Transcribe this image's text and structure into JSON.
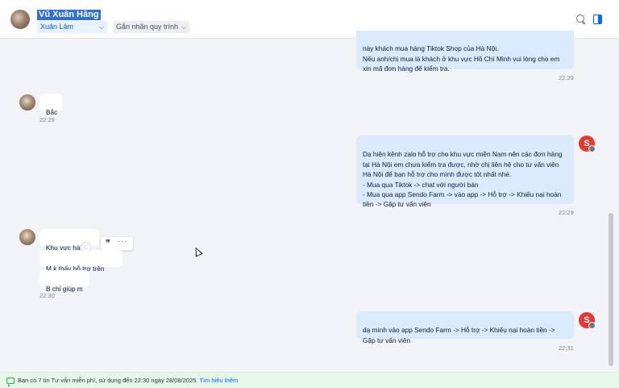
{
  "header": {
    "contact_name": "Vũ Xuân Hằng",
    "region_select": "Xuân Lâm",
    "tag_select": "Gắn nhãn quy trình"
  },
  "messages": {
    "m1": {
      "text": "này khách mua hàng Tiktok Shop của Hà Nội.\nNếu anh/chị mua là khách ở khu vực Hồ Chí Minh vui lòng cho em xin mã đơn hàng để kiểm tra.",
      "time": "22:29"
    },
    "m2": {
      "text": "Bắc",
      "time": "22:29"
    },
    "m3": {
      "text": "Dạ hiện kênh zalo hỗ trợ cho khu vực miền Nam nên các đơn hàng tại Hà Nội em chưa kiểm tra được, nhờ chị liên hệ cho tư vấn viên Hà Nội để bạn hỗ trợ cho mình được tốt nhất nhé.\n- Mua qua Tiktok -> chat với người bán\n- Mua qua app Sendo Farm -> vào app -> Hỗ trợ -> Khiếu nại hoàn tiền -> Gặp tư vấn viên",
      "time": "22:29"
    },
    "m4a": {
      "text": "Khu vực hà noiij"
    },
    "m4b": {
      "text": "M k thấy hỗ trợ trên app"
    },
    "m4c": {
      "text": "B chỉ giúp m",
      "time": "22:30"
    },
    "m5": {
      "text": "dạ mình vào app Sendo Farm -> Hỗ trợ -> Khiếu nại hoàn tiền -> Gặp tư vấn viên",
      "time": "22:31"
    }
  },
  "brand_avatar_letter": "S",
  "toolbar": {
    "quote_glyph": "❞",
    "more_glyph": "···",
    "heart_glyph": "♡"
  },
  "footer": {
    "text": "Bạn có 7 tin Tư vấn miễn phí, sử dụng đến 22:30 ngày 28/08/2025.",
    "link": "Tìm hiểu thêm"
  },
  "colors": {
    "accent": "#0068ff",
    "outgoing_bubble": "#dbebff",
    "brand": "#e53935",
    "footer_bg": "#e6f7e9"
  }
}
